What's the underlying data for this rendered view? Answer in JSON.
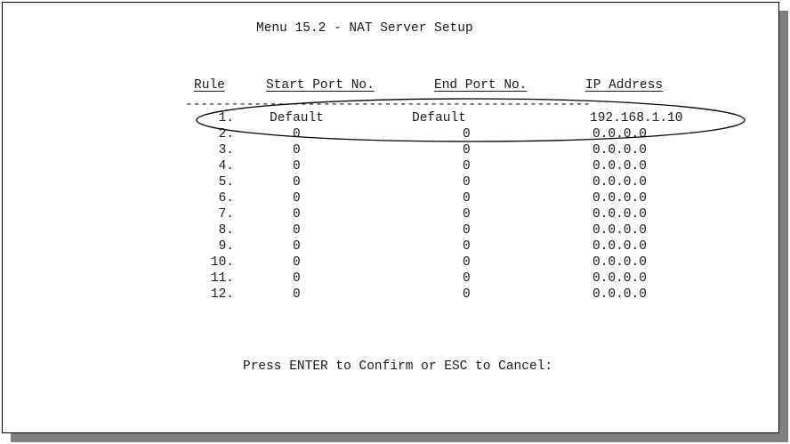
{
  "title": "Menu 15.2 - NAT Server Setup",
  "columns": {
    "rule": "Rule",
    "start_port": "Start Port No.",
    "end_port": "End Port No.",
    "ip_address": "IP Address"
  },
  "separator": "-----------------------------------------------------",
  "rows": [
    {
      "rule": "1.",
      "start": "Default",
      "end": "Default",
      "ip": "192.168.1.10"
    },
    {
      "rule": "2.",
      "start": "0",
      "end": "0",
      "ip": "0.0.0.0"
    },
    {
      "rule": "3.",
      "start": "0",
      "end": "0",
      "ip": "0.0.0.0"
    },
    {
      "rule": "4.",
      "start": "0",
      "end": "0",
      "ip": "0.0.0.0"
    },
    {
      "rule": "5.",
      "start": "0",
      "end": "0",
      "ip": "0.0.0.0"
    },
    {
      "rule": "6.",
      "start": "0",
      "end": "0",
      "ip": "0.0.0.0"
    },
    {
      "rule": "7.",
      "start": "0",
      "end": "0",
      "ip": "0.0.0.0"
    },
    {
      "rule": "8.",
      "start": "0",
      "end": "0",
      "ip": "0.0.0.0"
    },
    {
      "rule": "9.",
      "start": "0",
      "end": "0",
      "ip": "0.0.0.0"
    },
    {
      "rule": "10.",
      "start": "0",
      "end": "0",
      "ip": "0.0.0.0"
    },
    {
      "rule": "11.",
      "start": "0",
      "end": "0",
      "ip": "0.0.0.0"
    },
    {
      "rule": "12.",
      "start": "0",
      "end": "0",
      "ip": "0.0.0.0"
    }
  ],
  "prompt": "Press ENTER to Confirm or ESC to Cancel:",
  "highlighted_row": 1
}
